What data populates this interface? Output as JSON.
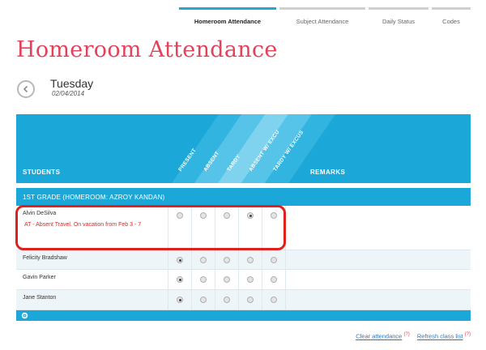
{
  "tabs": [
    {
      "label": "Homeroom Attendance",
      "active": true
    },
    {
      "label": "Subject Attendance",
      "active": false
    },
    {
      "label": "Daily Status",
      "active": false
    },
    {
      "label": "Codes",
      "active": false
    }
  ],
  "page_title": "Homeroom Attendance",
  "date_nav": {
    "day": "Tuesday",
    "date": "02/04/2014",
    "back_icon": "chevron-left-icon"
  },
  "table": {
    "students_header": "STUDENTS",
    "remarks_header": "REMARKS",
    "status_columns": [
      "PRESENT",
      "ABSENT",
      "TARDY",
      "ABSENT W/ EXCU",
      "TARDY W/ EXCUS"
    ],
    "group_label": "1ST GRADE (HOMEROOM: AZROY KANDAN)",
    "rows": [
      {
        "name": "Alvin DeSilva",
        "note": "AT - Absent Travel. On vacation from Feb 3 - 7",
        "selected": 3,
        "highlighted": true
      },
      {
        "name": "Felicity Bradshaw",
        "note": "",
        "selected": 0,
        "highlighted": false
      },
      {
        "name": "Gavin Parker",
        "note": "",
        "selected": 0,
        "highlighted": false
      },
      {
        "name": "Jane Stanton",
        "note": "",
        "selected": 0,
        "highlighted": false
      }
    ],
    "footer_icon": "gear-icon"
  },
  "footer": {
    "clear_label": "Clear attendance",
    "refresh_label": "Refresh class list",
    "help_marker": "(?)"
  },
  "colors": {
    "accent": "#1ba8d8",
    "title": "#e3425b",
    "highlight": "#e0201f",
    "note": "#d62a2a"
  }
}
